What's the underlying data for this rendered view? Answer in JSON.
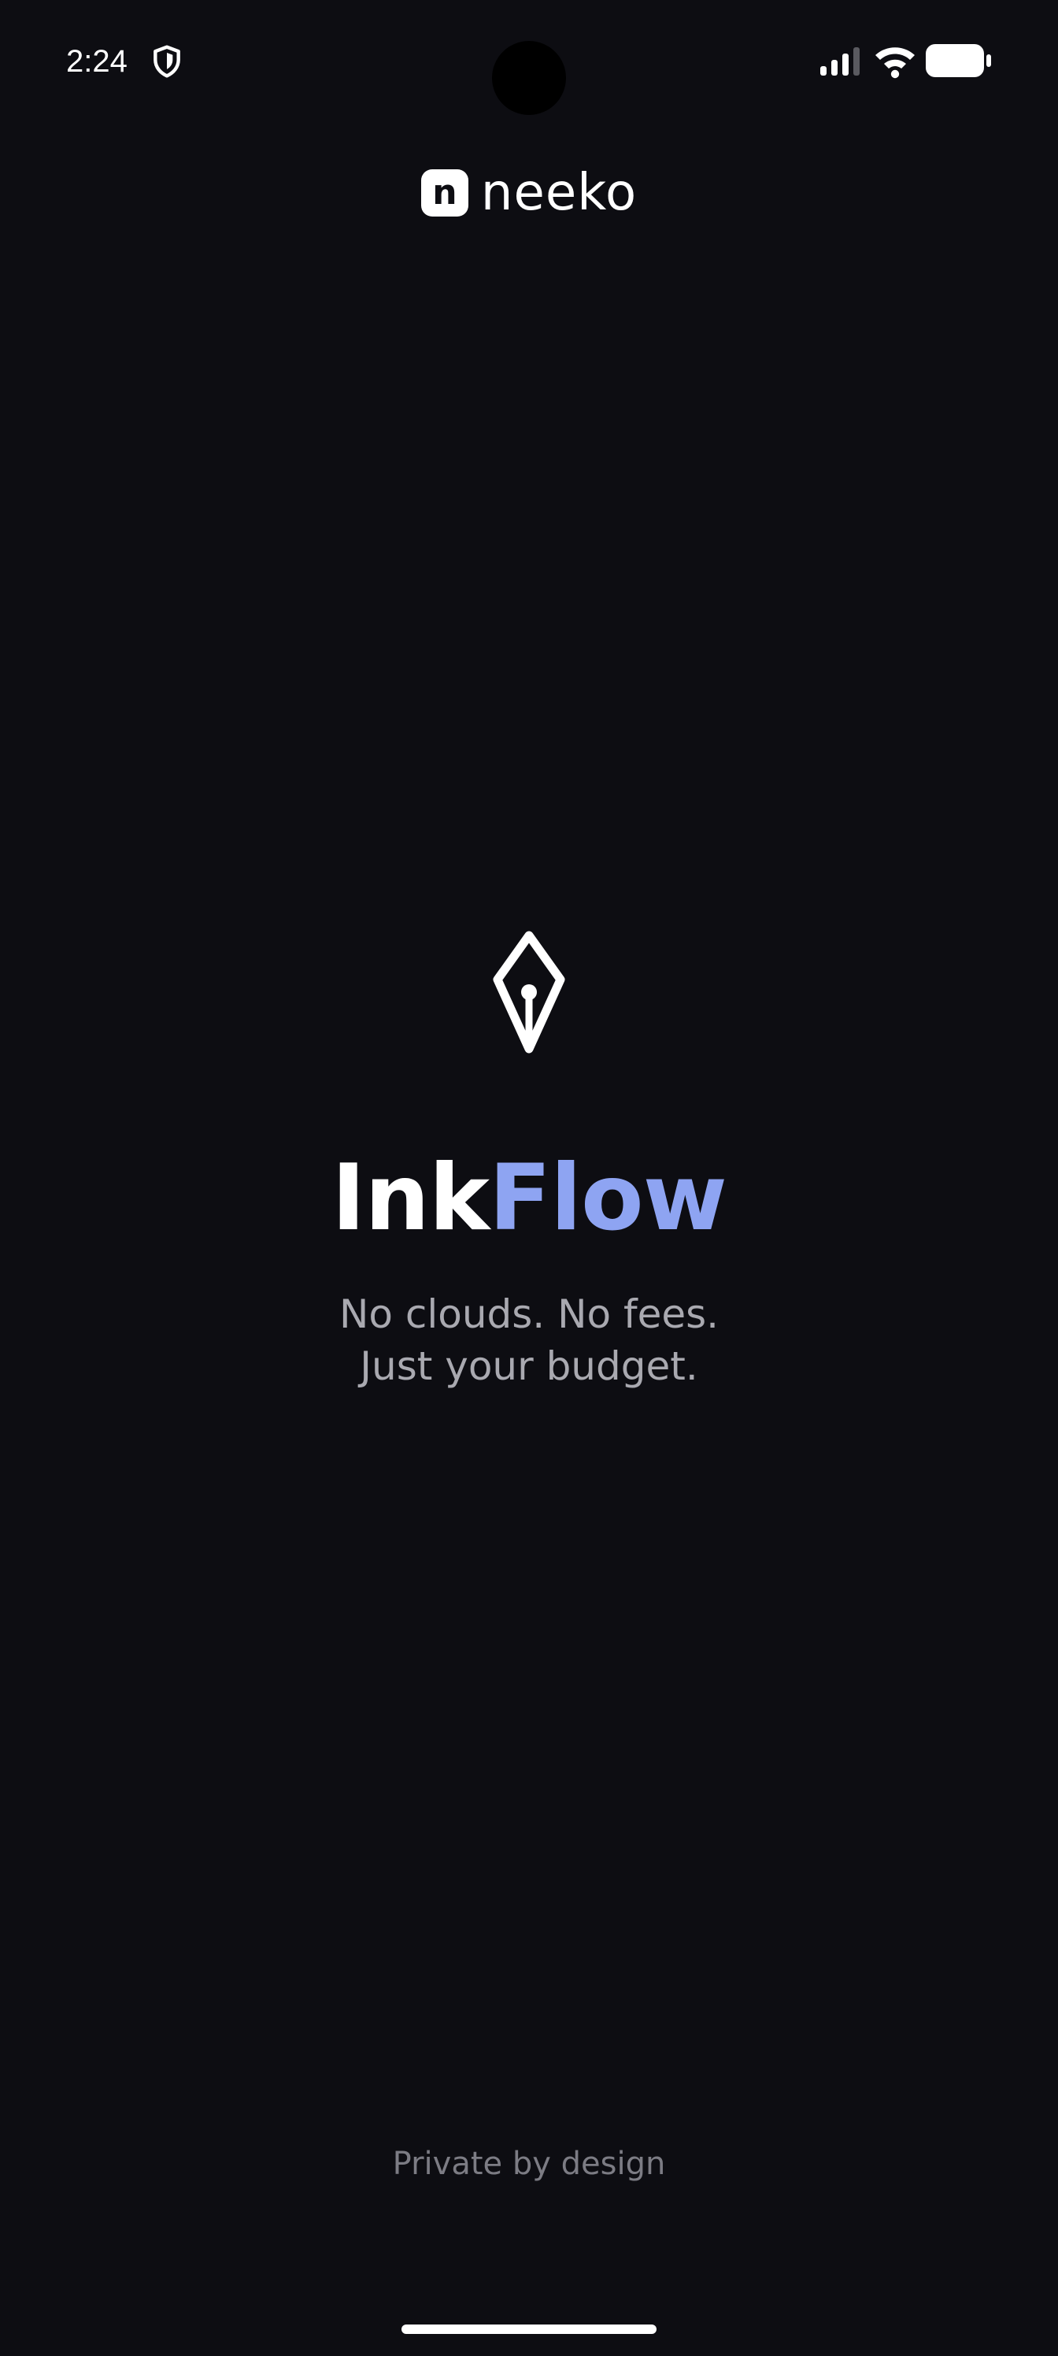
{
  "status_bar": {
    "time": "2:24",
    "icons": [
      "shield-icon",
      "signal-icon",
      "wifi-icon",
      "battery-icon"
    ]
  },
  "brand": {
    "mark_letter": "n",
    "name": "neeko"
  },
  "hero": {
    "icon": "pen-nib-icon",
    "title_part_1": "Ink",
    "title_part_2": "Flow",
    "tagline_line_1": "No clouds. No fees.",
    "tagline_line_2": "Just your budget."
  },
  "footer": {
    "text": "Private by design"
  },
  "colors": {
    "background": "#0d0d12",
    "accent": "#8ea4f2",
    "text_primary": "#ffffff",
    "text_secondary": "#a9a9b0",
    "text_muted": "#7c7c84"
  }
}
